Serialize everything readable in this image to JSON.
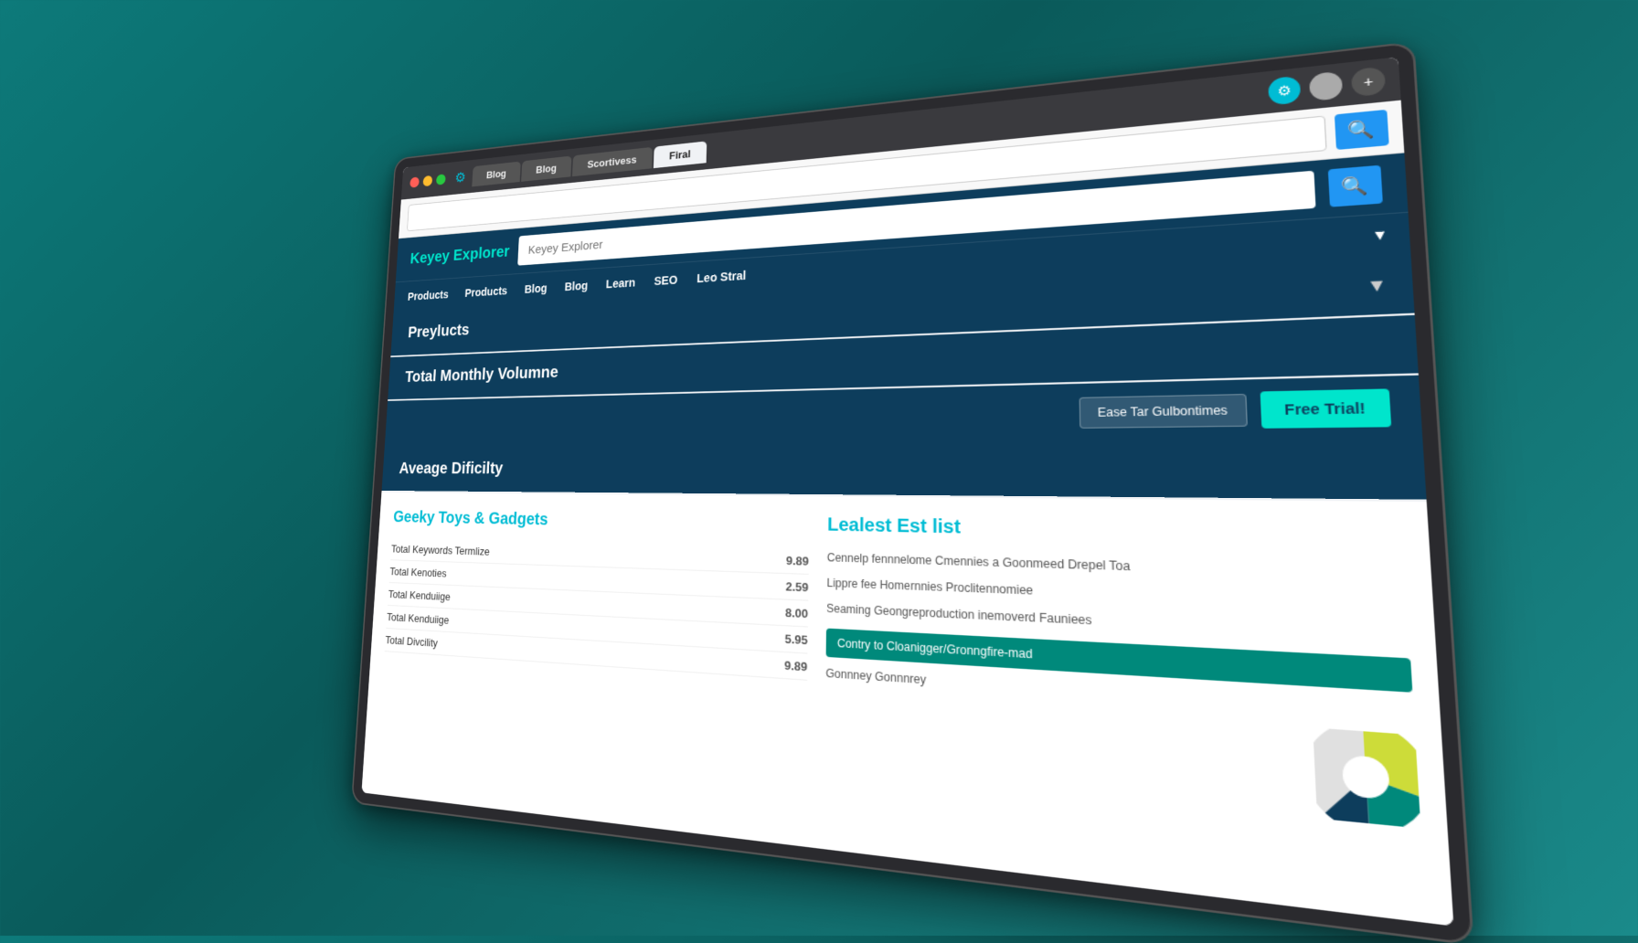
{
  "browser": {
    "traffic_lights": {
      "red_label": "close",
      "yellow_label": "minimize",
      "green_label": "maximize"
    },
    "gear_icon": "⚙",
    "tabs": [
      {
        "label": "Blog",
        "active": false
      },
      {
        "label": "Blog",
        "active": false
      },
      {
        "label": "Scortivess",
        "active": false
      },
      {
        "label": "Firal",
        "active": true
      }
    ],
    "tab_controls": {
      "settings_icon": "⚙",
      "plus_icon": "+"
    }
  },
  "url_bar": {
    "placeholder": "",
    "search_icon": "🔍"
  },
  "site": {
    "logo": "Keyey Explorer",
    "search_placeholder": "Keyey Explorer",
    "search_icon": "🔍"
  },
  "main_nav": {
    "items": [
      {
        "label": "Products"
      },
      {
        "label": "Products"
      },
      {
        "label": "Blog"
      },
      {
        "label": "Blog"
      },
      {
        "label": "Learn"
      },
      {
        "label": "SEO"
      },
      {
        "label": "Leo Stral"
      }
    ]
  },
  "sections": [
    {
      "id": "products",
      "title": "Preylucts",
      "has_chevron": true,
      "style": "dark"
    },
    {
      "id": "total-monthly",
      "title": "Total Monthly Volumne",
      "has_chevron": false,
      "style": "dark"
    },
    {
      "id": "average-difficulty",
      "title": "Aveage Dificilty",
      "has_chevron": false,
      "style": "dark"
    }
  ],
  "filter": {
    "filter_btn_label": "Ease Tar Gulbontimes",
    "free_trial_label": "Free Trial!"
  },
  "left_panel": {
    "title": "Geeky Toys & Gadgets",
    "rows": [
      {
        "label": "Total Keywords Termlize",
        "value": "9.89"
      },
      {
        "label": "Total Kenoties",
        "value": "2.59"
      },
      {
        "label": "Total Kenduiige",
        "value": "8.00"
      },
      {
        "label": "Total Kenduiige",
        "value": "5.95"
      },
      {
        "label": "Total Divcility",
        "value": "9.89"
      }
    ]
  },
  "right_panel": {
    "title": "Lealest Est list",
    "lines": [
      "Cennelp fennnelome Cmennies a Goonmeed Drepel Toa",
      "Lippre fee Homernnies Proclitennomiee",
      "Seaming Geongreproduction inemoverd Fauniees",
      "Contry to Cloanigger/Gronngfire-mad",
      "Gonnney Gonnnrey"
    ],
    "chart_btn": "Contry to Cloanigger/Gronngfire-mad"
  },
  "colors": {
    "primary_dark": "#0d3d5c",
    "teal_accent": "#00bcd4",
    "teal_light": "#00e5cc",
    "blue_btn": "#2196f3",
    "background": "#0a6a6a"
  }
}
